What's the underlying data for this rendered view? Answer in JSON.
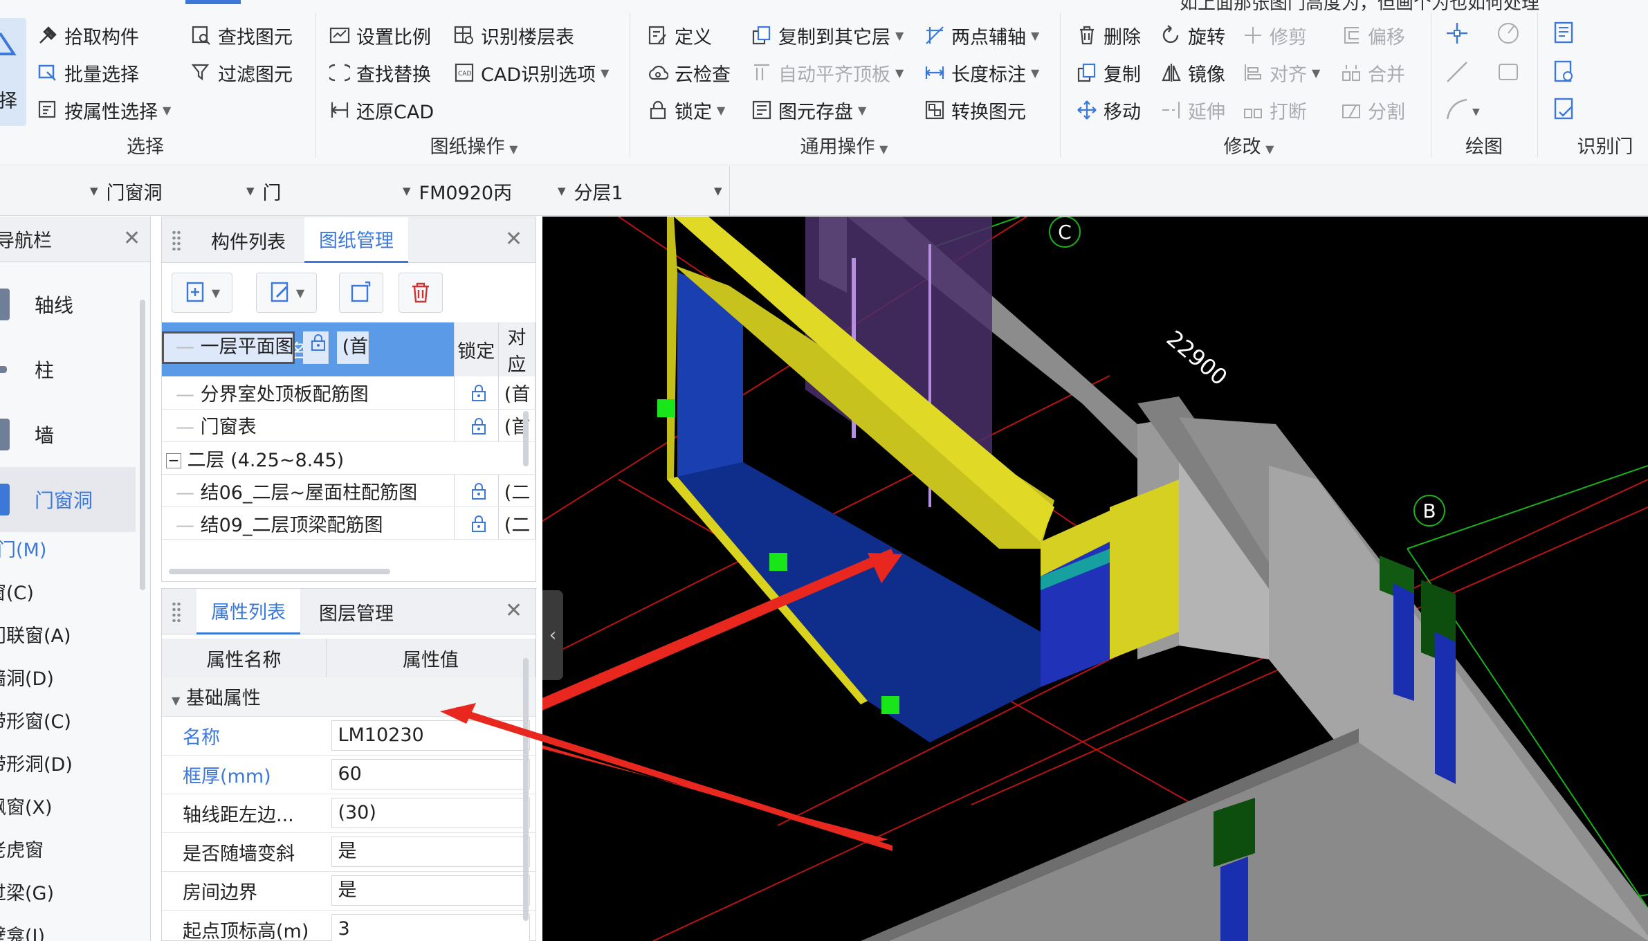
{
  "ribbon": {
    "select_group": {
      "label_partial": "择",
      "picker": "拾取构件",
      "batch": "批量选择",
      "by_prop": "按属性选择",
      "group": "选择"
    },
    "find_group": {
      "find": "查找图元",
      "filter": "过滤图元"
    },
    "drawing_ops": {
      "scale": "设置比例",
      "identify_floor": "识别楼层表",
      "find_replace": "查找替换",
      "cad_options": "CAD识别选项",
      "restore_cad": "还原CAD",
      "group": "图纸操作"
    },
    "general_ops": {
      "define": "定义",
      "copy_to_floor": "复制到其它层",
      "two_point_axis": "两点辅轴",
      "cloud_check": "云检查",
      "auto_align_slab": "自动平齐顶板",
      "length_dim": "长度标注",
      "lock": "锁定",
      "save_elements": "图元存盘",
      "convert": "转换图元",
      "group": "通用操作"
    },
    "modify": {
      "delete": "删除",
      "rotate": "旋转",
      "trim": "修剪",
      "offset": "偏移",
      "copy": "复制",
      "mirror": "镜像",
      "align": "对齐",
      "merge": "合并",
      "move": "移动",
      "extend": "延伸",
      "break": "打断",
      "split": "分割",
      "group": "修改"
    },
    "draw_group": "绘图",
    "identify_door": "识别门",
    "top_cut_text": "如上面那张图门高度为，但画个为也如何处理"
  },
  "selectors": [
    "门窗洞",
    "门",
    "FM0920丙",
    "分层1"
  ],
  "nav": {
    "title": "导航栏",
    "items": [
      {
        "label": "轴线"
      },
      {
        "label": "柱"
      },
      {
        "label": "墙"
      },
      {
        "label": "门窗洞"
      }
    ],
    "sub": [
      "门(M)",
      "窗(C)",
      "门联窗(A)",
      "墙洞(D)",
      "带形窗(C)",
      "带形洞(D)",
      "飘窗(X)",
      "老虎窗",
      "过梁(G)",
      "壁龛(I)"
    ]
  },
  "drawing_panel": {
    "tabs": [
      "构件列表",
      "图纸管理"
    ],
    "headers": [
      "名称",
      "锁定",
      "对应"
    ],
    "rows": [
      {
        "name": "分界室处顶板配筋图",
        "owner": "(首"
      },
      {
        "name": "一层平面图",
        "owner": "(首"
      },
      {
        "name": "门窗表",
        "owner": "(首"
      },
      {
        "name": "二层 (4.25~8.45)",
        "owner": ""
      },
      {
        "name": "结06_二层~屋面柱配筋图",
        "owner": "(二"
      },
      {
        "name": "结09_二层顶梁配筋图",
        "owner": "(二"
      }
    ],
    "collapse_mark": "−"
  },
  "props_panel": {
    "tabs": [
      "属性列表",
      "图层管理"
    ],
    "headers": [
      "属性名称",
      "属性值"
    ],
    "section": "基础属性",
    "rows": [
      {
        "name": "名称",
        "value": "LM10230"
      },
      {
        "name": "框厚(mm)",
        "value": "60"
      },
      {
        "name": "轴线距左边...",
        "value": "(30)"
      },
      {
        "name": "是否随墙变斜",
        "value": "是"
      },
      {
        "name": "房间边界",
        "value": "是"
      },
      {
        "name": "起点顶标高(m)",
        "value": "3"
      }
    ]
  },
  "viewport": {
    "axis_labels": [
      "C",
      "B"
    ],
    "dimension": "22900",
    "collapse_arrow": "‹"
  },
  "colors": {
    "accent": "#3b78d8",
    "yellow": "#d9d21f",
    "blue": "#1638a6",
    "green_grip": "#19e619",
    "red_arrow": "#e8281f"
  }
}
